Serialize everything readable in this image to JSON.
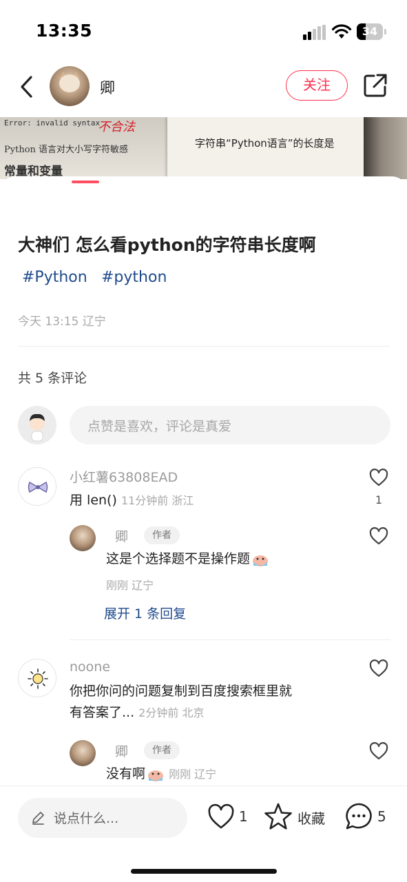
{
  "status_bar": {
    "time": "13:35",
    "battery": "34",
    "battery_level": 0.34
  },
  "header": {
    "author_name": "卿",
    "follow_label": "关注",
    "icons": [
      "back-icon",
      "share-icon"
    ]
  },
  "image_preview": {
    "left_error": "Error: invalid syntax",
    "left_scribble": "不合法",
    "left_line2": "Python 语言对大小写字符敏感",
    "left_line3": "常量和变量",
    "mid_text": "字符串“Python语言”的长度是"
  },
  "post": {
    "title": "大神们 怎么看python的字符串长度啊",
    "tags": [
      "#Python",
      "#python"
    ],
    "meta": "今天 13:15 辽宁"
  },
  "comments_section": {
    "count_label": "共 5 条评论",
    "input_placeholder": "点赞是喜欢，评论是真爱"
  },
  "comments": [
    {
      "user": "小红薯63808EAD",
      "text": "用 len()",
      "meta": "11分钟前 浙江",
      "likes": "1",
      "reply": {
        "user": "卿",
        "badge": "作者",
        "text": "这是个选择题不是操作题",
        "meta": "刚刚 辽宁"
      },
      "expand_label": "展开 1 条回复"
    },
    {
      "user": "noone",
      "text_line1": "你把你问的问题复制到百度搜索框里就",
      "text_line2": "有答案了...",
      "meta": "2分钟前 北京",
      "reply": {
        "user": "卿",
        "badge": "作者",
        "text": "没有啊",
        "meta": "刚刚 辽宁"
      }
    }
  ],
  "bottom_bar": {
    "input_placeholder": "说点什么...",
    "like_count": "1",
    "collect_label": "收藏",
    "comment_count": "5"
  },
  "colors": {
    "accent": "#ff2e4d",
    "tag": "#1f4a8c",
    "muted": "#a9a9a9"
  }
}
